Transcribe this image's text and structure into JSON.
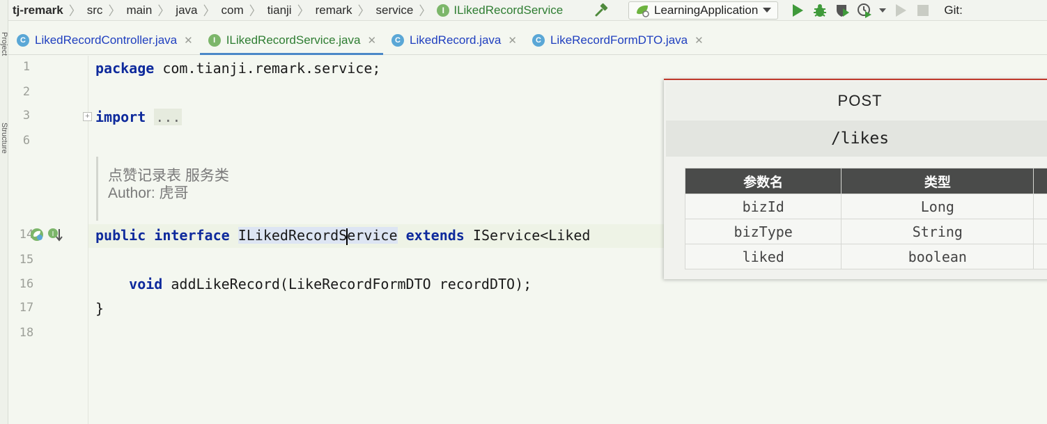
{
  "navbar": {
    "breadcrumbs": [
      "tj-remark",
      "src",
      "main",
      "java",
      "com",
      "tianji",
      "remark",
      "service"
    ],
    "current_file": "ILikedRecordService",
    "run_config": "LearningApplication",
    "git_label": "Git:"
  },
  "left_strip": {
    "label_top": "Project",
    "label_mid": "Structure"
  },
  "tabs": [
    {
      "label": "LikedRecordController.java",
      "kind": "class"
    },
    {
      "label": "ILikedRecordService.java",
      "kind": "interface",
      "active": true
    },
    {
      "label": "LikedRecord.java",
      "kind": "class"
    },
    {
      "label": "LikeRecordFormDTO.java",
      "kind": "class"
    }
  ],
  "gutter": {
    "line_numbers": [
      "1",
      "2",
      "3",
      "6",
      "14",
      "15",
      "16",
      "17",
      "18"
    ]
  },
  "code": {
    "package_kw": "package",
    "package_name": " com.tianji.remark.service;",
    "import_kw": "import",
    "import_rest": "...",
    "doc_line1": "点赞记录表 服务类",
    "doc_line2": "Author: 虎哥",
    "line14": {
      "public_kw": "public",
      "interface_kw": "interface",
      "name_before": "ILikedRecordS",
      "name_after": "ervice",
      "extends_kw": "extends",
      "rest": " IService<Liked"
    },
    "line16": {
      "void_kw": "void",
      "rest": " addLikeRecord(LikeRecordFormDTO recordDTO);"
    },
    "line17": "}"
  },
  "popup": {
    "method": "POST",
    "path": "/likes",
    "headers": [
      "参数名",
      "类型"
    ],
    "rows": [
      [
        "bizId",
        "Long"
      ],
      [
        "bizType",
        "String"
      ],
      [
        "liked",
        "boolean"
      ]
    ]
  },
  "colors": {
    "keyword": "#0e2a9c",
    "interface_green": "#2e7d32",
    "class_tab_blue": "#1f3fbf",
    "popup_accent": "#c0392b",
    "table_header": "#4a4b4a"
  }
}
